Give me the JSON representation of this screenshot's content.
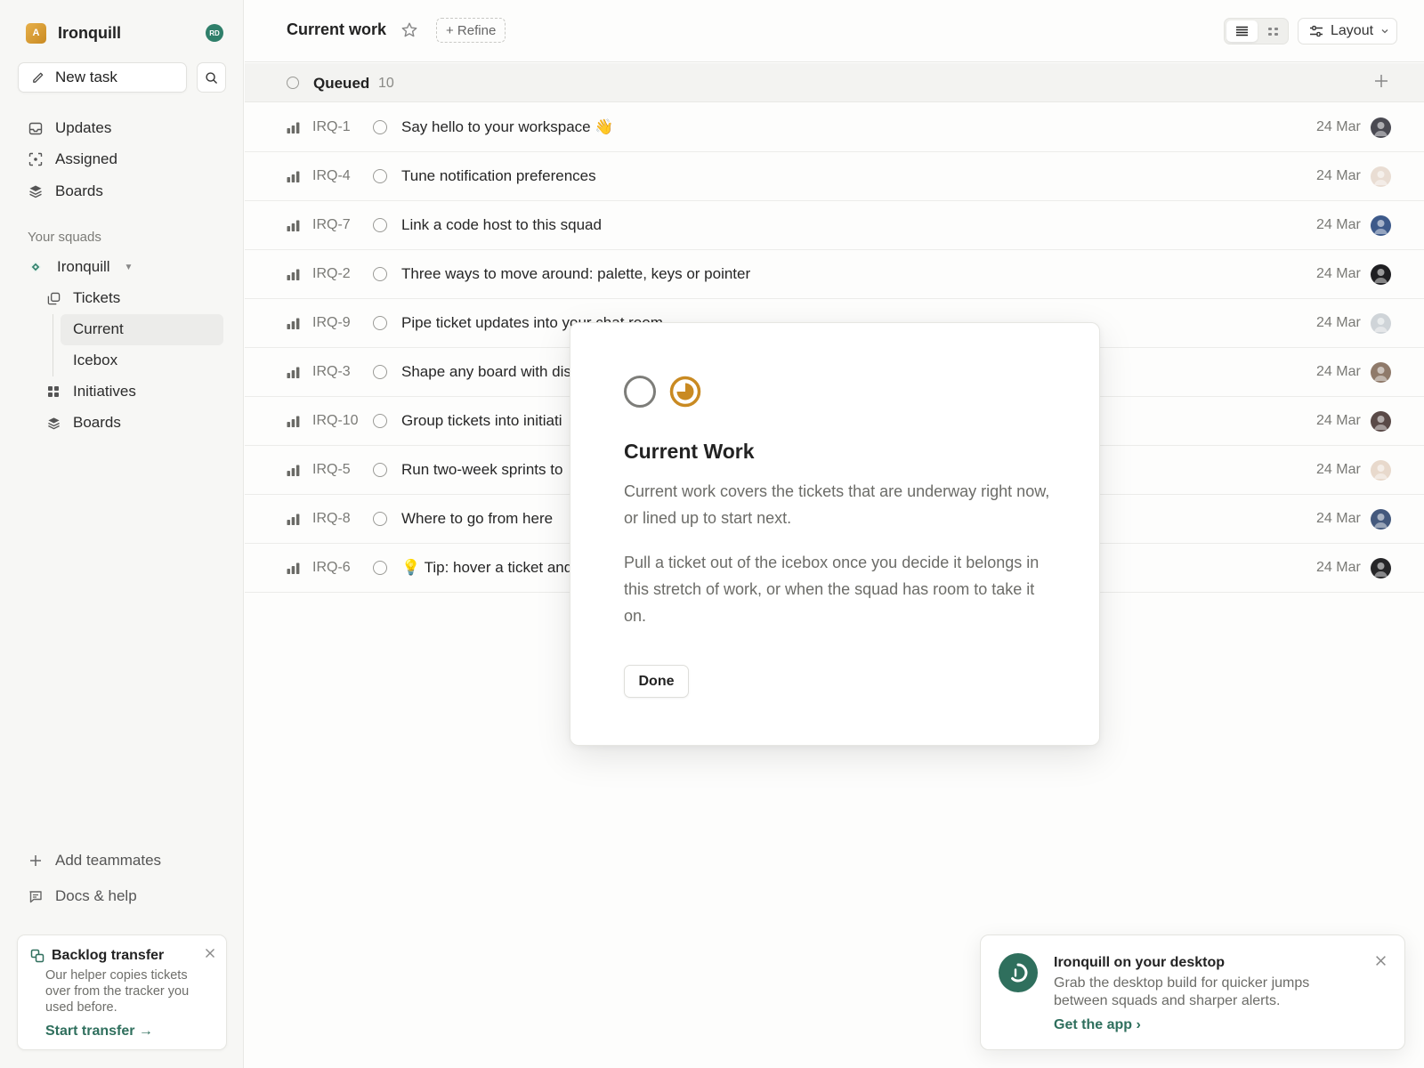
{
  "workspace": {
    "name": "Ironquill",
    "logo_letter": "A",
    "user_initials": "RD"
  },
  "sidebar": {
    "new_task_label": "New task",
    "nav": [
      {
        "label": "Updates",
        "icon": "inbox-icon"
      },
      {
        "label": "Assigned",
        "icon": "focus-icon"
      },
      {
        "label": "Boards",
        "icon": "layers-icon"
      }
    ],
    "squads_label": "Your squads",
    "squad": {
      "name": "Ironquill",
      "items": [
        {
          "label": "Tickets",
          "icon": "copy-icon"
        },
        {
          "label": "Current",
          "icon": ""
        },
        {
          "label": "Icebox",
          "icon": ""
        },
        {
          "label": "Initiatives",
          "icon": "grid-icon"
        },
        {
          "label": "Boards",
          "icon": "layers-icon"
        }
      ]
    },
    "add_teammates": "Add teammates",
    "docs_help": "Docs & help",
    "transfer_card": {
      "title": "Backlog transfer",
      "body": "Our helper copies tickets over from the tracker you used before.",
      "link": "Start transfer →"
    }
  },
  "header": {
    "title": "Current work",
    "refine_label": "+ Refine",
    "layout_label": "Layout"
  },
  "group": {
    "label": "Queued",
    "count": "10"
  },
  "rows": [
    {
      "id": "IRQ-1",
      "title": "Say hello to your workspace 👋",
      "date": "24 Mar"
    },
    {
      "id": "IRQ-4",
      "title": "Tune notification preferences",
      "date": "24 Mar"
    },
    {
      "id": "IRQ-7",
      "title": "Link a code host to this squad",
      "date": "24 Mar"
    },
    {
      "id": "IRQ-2",
      "title": "Three ways to move around: palette, keys or pointer",
      "date": "24 Mar"
    },
    {
      "id": "IRQ-9",
      "title": "Pipe ticket updates into your chat room",
      "date": "24 Mar"
    },
    {
      "id": "IRQ-3",
      "title": "Shape any board with dis",
      "date": "24 Mar"
    },
    {
      "id": "IRQ-10",
      "title": "Group tickets into initiati",
      "date": "24 Mar"
    },
    {
      "id": "IRQ-5",
      "title": "Run two-week sprints to",
      "date": "24 Mar"
    },
    {
      "id": "IRQ-8",
      "title": "Where to go from here",
      "date": "24 Mar"
    },
    {
      "id": "IRQ-6",
      "title": "💡 Tip: hover a ticket and",
      "date": "24 Mar"
    }
  ],
  "modal": {
    "title": "Current Work",
    "p1": "Current work covers the tickets that are underway right now, or lined up to start next.",
    "p2": "Pull a ticket out of the icebox once you decide it belongs in this stretch of work, or when the squad has room to take it on.",
    "done_label": "Done"
  },
  "toast": {
    "title": "Ironquill on your desktop",
    "body": "Grab the desktop build for quicker jumps between squads and sharper alerts.",
    "link": "Get the app ›"
  },
  "colors": {
    "accent": "#2f6f5d",
    "progress": "#c98a22"
  }
}
